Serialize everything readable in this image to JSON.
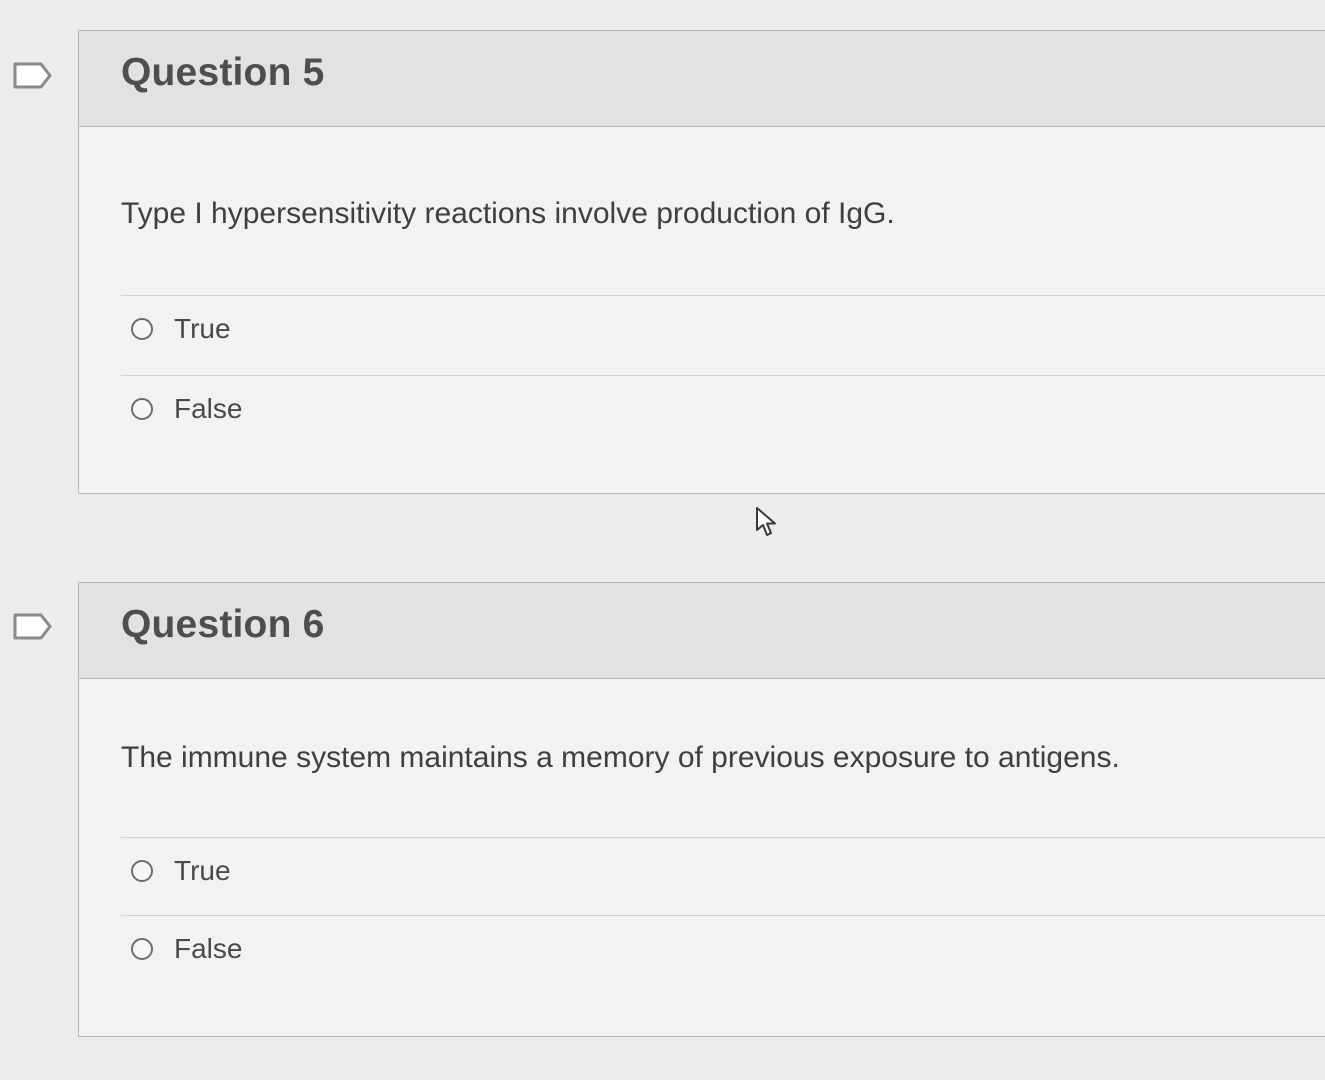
{
  "questions": [
    {
      "title": "Question 5",
      "text": "Type I hypersensitivity reactions involve production of IgG.",
      "answers": [
        "True",
        "False"
      ]
    },
    {
      "title": "Question 6",
      "text": "The immune system maintains a memory of previous exposure to antigens.",
      "answers": [
        "True",
        "False"
      ]
    }
  ],
  "icons": {
    "bookmark": "bookmark-flag-icon",
    "cursor": "mouse-pointer-icon"
  },
  "colors": {
    "page_background": "#ececec",
    "header_background": "#e2e2e2",
    "panel_background": "#f2f2f2",
    "border": "#b5b5b5",
    "text": "#4a4a4a"
  }
}
